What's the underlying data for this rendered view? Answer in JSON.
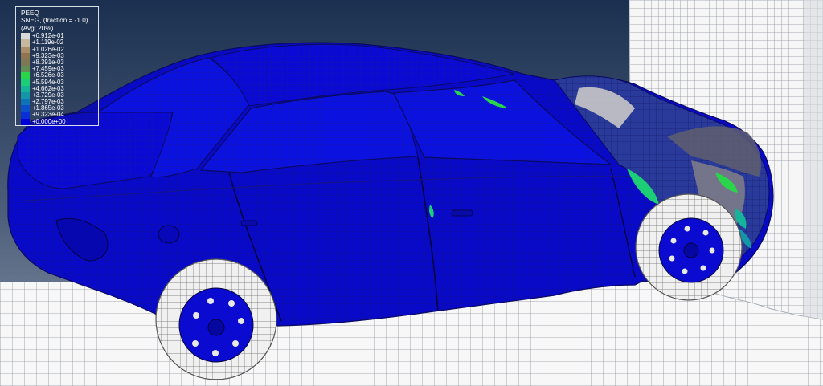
{
  "legend": {
    "variable": "PEEQ",
    "section_point": "SNEG, (fraction = -1.0)",
    "averaging": "(Avg: 20%)",
    "entries": [
      {
        "value": "+6.912e-01",
        "color": "#d9d9d9"
      },
      {
        "value": "+1.119e-02",
        "color": "#c8b8a0"
      },
      {
        "value": "+1.026e-02",
        "color": "#a98c68"
      },
      {
        "value": "+9.323e-03",
        "color": "#8f7452"
      },
      {
        "value": "+8.391e-03",
        "color": "#7e7856"
      },
      {
        "value": "+7.459e-03",
        "color": "#5f8f54"
      },
      {
        "value": "+6.526e-03",
        "color": "#29d64a"
      },
      {
        "value": "+5.594e-03",
        "color": "#1ccf77"
      },
      {
        "value": "+4.662e-03",
        "color": "#14b39a"
      },
      {
        "value": "+3.729e-03",
        "color": "#1396a8"
      },
      {
        "value": "+2.797e-03",
        "color": "#0f73b8"
      },
      {
        "value": "+1.865e-03",
        "color": "#0b50c8"
      },
      {
        "value": "+9.323e-04",
        "color": "#0a2fd6"
      },
      {
        "value": "+0.000e+00",
        "color": "#0000d8"
      }
    ]
  },
  "colors": {
    "background_top": "#1b3050",
    "background_bottom": "#8893a6",
    "car_body": "#0909c8",
    "mesh_line": "#101070",
    "tire": "#f0f0f0",
    "rigid_surface": "#f7f7f7"
  },
  "icons": {
    "model": "crashed-car-fe-model-icon",
    "wall": "rigid-wall-icon",
    "floor": "rigid-floor-icon"
  }
}
